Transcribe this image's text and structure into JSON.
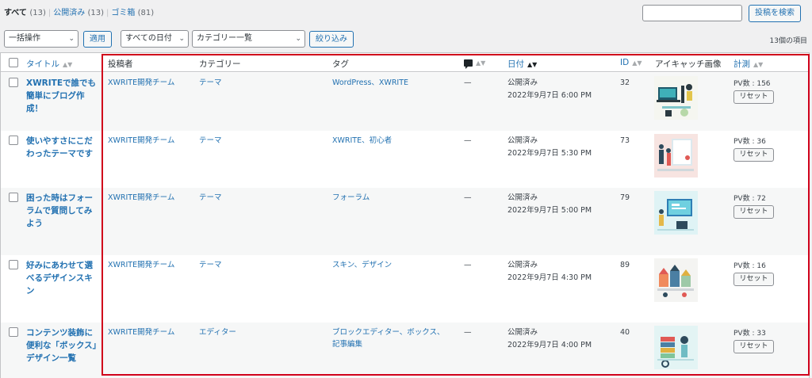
{
  "filters": {
    "all_label": "すべて",
    "all_count": "(13)",
    "published_label": "公開済み",
    "published_count": "(13)",
    "trash_label": "ゴミ箱",
    "trash_count": "(81)"
  },
  "search": {
    "value": "",
    "placeholder": "",
    "button_label": "投稿を検索"
  },
  "bulk": {
    "selected": "一括操作",
    "apply_label": "適用"
  },
  "date_filter": {
    "selected": "すべての日付"
  },
  "category_filter": {
    "selected": "カテゴリー一覧"
  },
  "filter_button_label": "絞り込み",
  "items_count": "13個の項目",
  "columns": {
    "title": "タイトル",
    "author": "投稿者",
    "categories": "カテゴリー",
    "tags": "タグ",
    "date": "日付",
    "id": "ID",
    "thumbnail": "アイキャッチ画像",
    "pv": "計測"
  },
  "posts": [
    {
      "title": "XWRITEで誰でも簡単にブログ作成！",
      "author": "XWRITE開発チーム",
      "category": "テーマ",
      "tags": "WordPress、XWRITE",
      "comments": "—",
      "status": "公開済み",
      "date": "2022年9月7日 6:00 PM",
      "id": "32",
      "pv": "PV数 : 156",
      "reset_label": "リセット"
    },
    {
      "title": "使いやすさにこだわったテーマです",
      "author": "XWRITE開発チーム",
      "category": "テーマ",
      "tags": "XWRITE、初心者",
      "comments": "—",
      "status": "公開済み",
      "date": "2022年9月7日 5:30 PM",
      "id": "73",
      "pv": "PV数 : 36",
      "reset_label": "リセット"
    },
    {
      "title": "困った時はフォーラムで質問してみよう",
      "author": "XWRITE開発チーム",
      "category": "テーマ",
      "tags": "フォーラム",
      "comments": "—",
      "status": "公開済み",
      "date": "2022年9月7日 5:00 PM",
      "id": "79",
      "pv": "PV数 : 72",
      "reset_label": "リセット"
    },
    {
      "title": "好みにあわせて選べるデザインスキン",
      "author": "XWRITE開発チーム",
      "category": "テーマ",
      "tags": "スキン、デザイン",
      "comments": "—",
      "status": "公開済み",
      "date": "2022年9月7日 4:30 PM",
      "id": "89",
      "pv": "PV数 : 16",
      "reset_label": "リセット"
    },
    {
      "title": "コンテンツ装飾に便利な「ボックス」デザイン一覧",
      "author": "XWRITE開発チーム",
      "category": "エディター",
      "tags": "ブロックエディター、ボックス、記事編集",
      "comments": "—",
      "status": "公開済み",
      "date": "2022年9月7日 4:00 PM",
      "id": "40",
      "pv": "PV数 : 33",
      "reset_label": "リセット"
    }
  ],
  "colors": {
    "link": "#2271b1",
    "highlight_border": "#d0021b",
    "row_alt": "#f6f7f7"
  }
}
